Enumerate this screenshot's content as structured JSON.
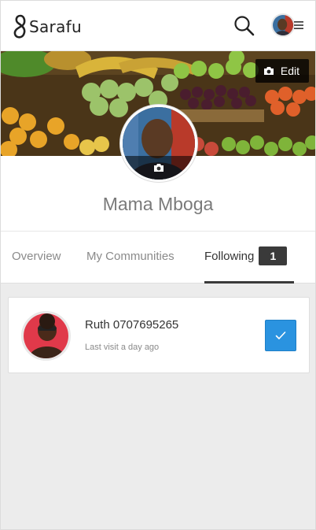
{
  "app": {
    "logo_text": "Sarafu",
    "brand_color": "#222222"
  },
  "header": {
    "search_icon": "search-icon",
    "menu_icon": "hamburger-icon"
  },
  "cover": {
    "edit_label": "Edit",
    "edit_icon": "camera-icon"
  },
  "profile": {
    "name": "Mama Mboga",
    "photo_icon": "camera-icon"
  },
  "tabs": [
    {
      "label": "Overview",
      "active": false
    },
    {
      "label": "My Communities",
      "active": false
    },
    {
      "label": "Following",
      "active": true,
      "badge": "1"
    }
  ],
  "following": [
    {
      "name": "Ruth 0707695265",
      "last_visit": "Last visit a day ago",
      "followed": true
    }
  ],
  "colors": {
    "accent": "#2a93e0",
    "tab_active": "#3a3a3a",
    "background": "#ececec"
  }
}
